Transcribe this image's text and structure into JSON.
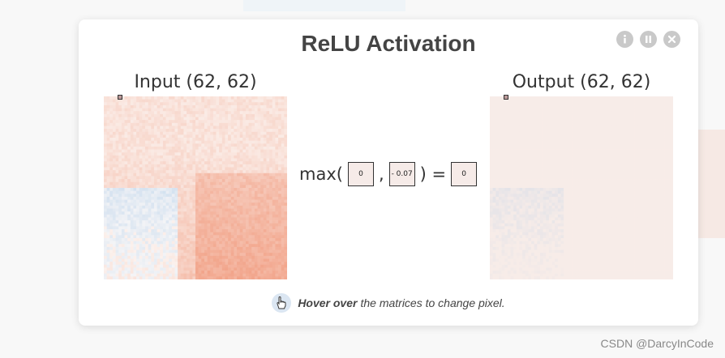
{
  "modal": {
    "title": "ReLU Activation",
    "input_label": "Input (62, 62)",
    "output_label": "Output (62, 62)",
    "equation": {
      "prefix": "max(",
      "comma": ",",
      "close_eq": ") =",
      "left_value": "0",
      "pixel_value": "- 0.07",
      "result_value": "0"
    },
    "hint": {
      "bold": "Hover over",
      "rest": "the matrices to change pixel."
    },
    "controls": [
      "info-icon",
      "pause-icon",
      "close-icon"
    ]
  },
  "watermark": "CSDN @DarcyInCode",
  "colors": {
    "positive": "#f2a48a",
    "negative": "#9fc3e6",
    "neutral": "#f7ece8"
  }
}
